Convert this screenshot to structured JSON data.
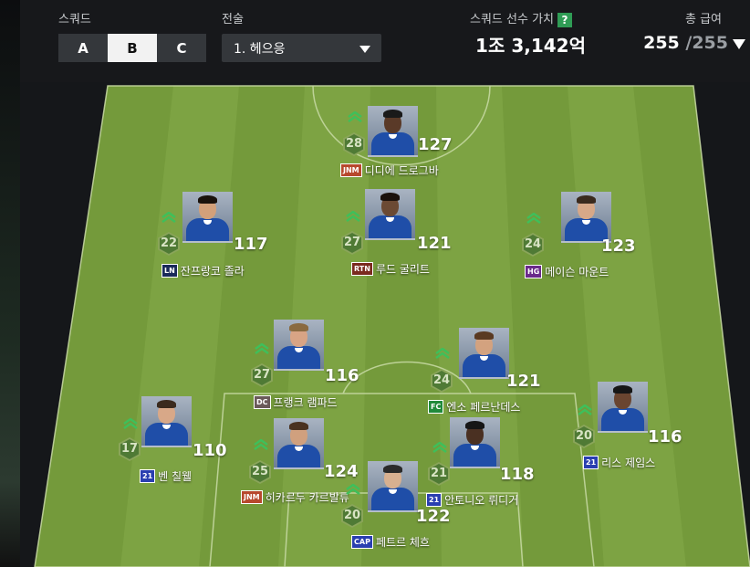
{
  "header": {
    "squad_label": "스쿼드",
    "squads": [
      "A",
      "B",
      "C"
    ],
    "active_squad": "B",
    "tactic_label": "전술",
    "tactic_value": "1. 헤으응",
    "value_label": "스쿼드 선수 가치",
    "help_glyph": "?",
    "value": "1조 3,142억",
    "salary_label": "총 급여",
    "salary_used": "255",
    "salary_total": "/255"
  },
  "colors": {
    "pitch_light": "#7da343",
    "pitch_dark": "#729939",
    "accent_green": "#2f9c55"
  },
  "players": [
    {
      "key": "drogba",
      "name": "디디에 드로그바",
      "ovr": "127",
      "level": "28",
      "season": "JNM",
      "season_color": "#b7482d",
      "hair": "#1a1a1a",
      "skin": "#5a3a28"
    },
    {
      "key": "zola",
      "name": "잔프랑코 졸라",
      "ovr": "117",
      "level": "22",
      "season": "LN",
      "season_color": "#1a2a5a",
      "hair": "#1a120c",
      "skin": "#d2a07a"
    },
    {
      "key": "gullit",
      "name": "루드 굴리트",
      "ovr": "121",
      "level": "27",
      "season": "RTN",
      "season_color": "#7a2a1f",
      "hair": "#1b120c",
      "skin": "#6b4a34"
    },
    {
      "key": "mount",
      "name": "메이슨 마운트",
      "ovr": "123",
      "level": "24",
      "season": "HG",
      "season_color": "#6a2a8a",
      "hair": "#3a2a1e",
      "skin": "#d7a888"
    },
    {
      "key": "lampard",
      "name": "프랭크 램파드",
      "ovr": "116",
      "level": "27",
      "season": "DC",
      "season_color": "#6a5a5a",
      "hair": "#8a6a40",
      "skin": "#d8a485"
    },
    {
      "key": "enzo",
      "name": "엔소 페르난데스",
      "ovr": "121",
      "level": "24",
      "season": "FC",
      "season_color": "#1f8a3a",
      "hair": "#5a3a22",
      "skin": "#d3a27f"
    },
    {
      "key": "chilwell",
      "name": "벤 칠웰",
      "ovr": "110",
      "level": "17",
      "season": "21",
      "season_color": "#2a3fb0",
      "hair": "#3a2a1e",
      "skin": "#d8a888"
    },
    {
      "key": "carvalho",
      "name": "히카르두 카르발류",
      "ovr": "124",
      "level": "25",
      "season": "JNM",
      "season_color": "#b7482d",
      "hair": "#4a3220",
      "skin": "#d0a07e"
    },
    {
      "key": "rudiger",
      "name": "안토니오 뤼디거",
      "ovr": "118",
      "level": "21",
      "season": "21",
      "season_color": "#2a3fb0",
      "hair": "#161616",
      "skin": "#4a3022"
    },
    {
      "key": "james",
      "name": "리스 제임스",
      "ovr": "116",
      "level": "20",
      "season": "21",
      "season_color": "#2a3fb0",
      "hair": "#161616",
      "skin": "#6a4530"
    },
    {
      "key": "cech",
      "name": "페트르 체흐",
      "ovr": "122",
      "level": "20",
      "season": "CAP",
      "season_color": "#2a3fb0",
      "hair": "#2a2a2a",
      "skin": "#d8b090"
    }
  ]
}
